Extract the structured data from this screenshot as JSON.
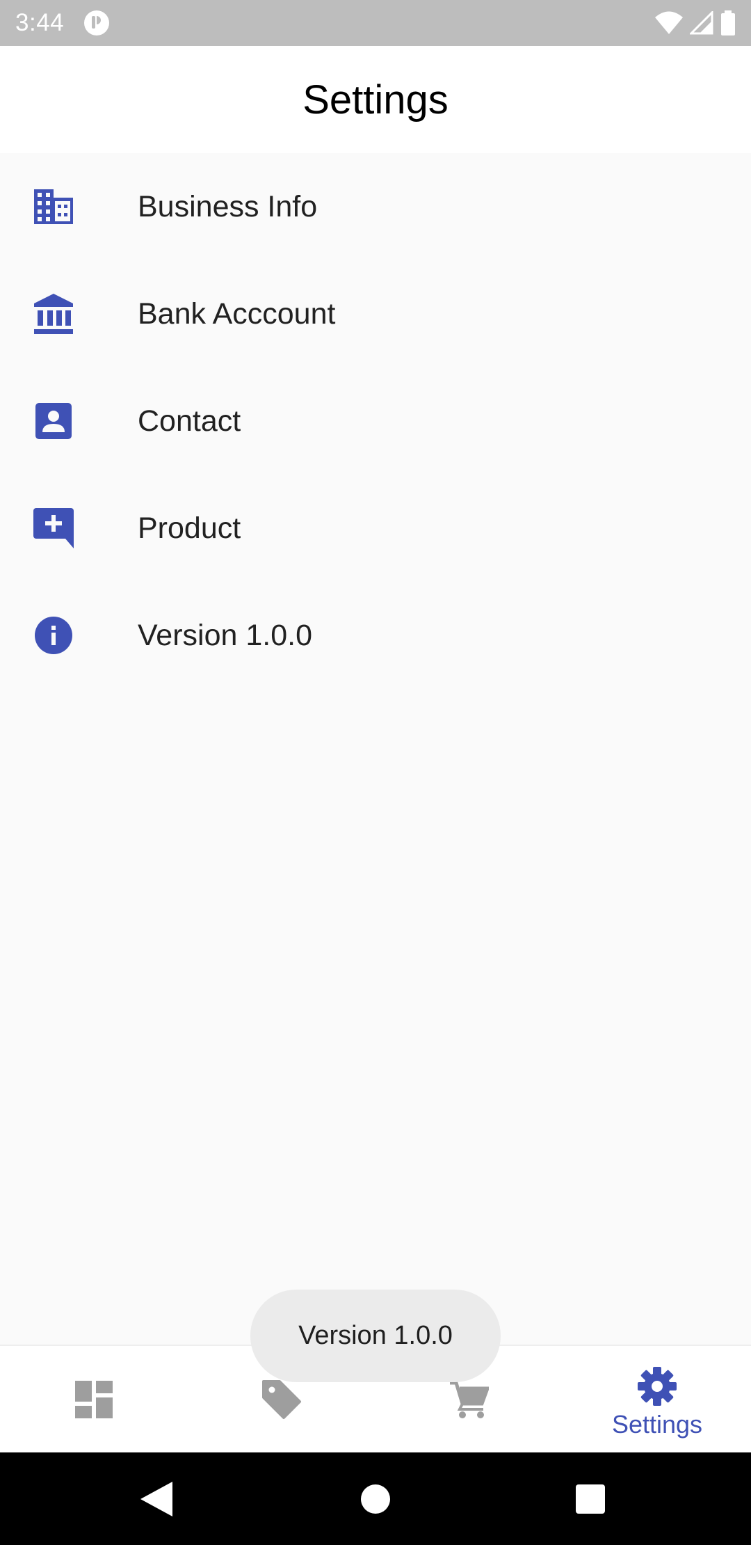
{
  "status_bar": {
    "time": "3:44"
  },
  "app_bar": {
    "title": "Settings"
  },
  "settings_items": [
    {
      "label": "Business Info",
      "icon": "business-icon"
    },
    {
      "label": "Bank Acccount",
      "icon": "bank-icon"
    },
    {
      "label": "Contact",
      "icon": "contact-card-icon"
    },
    {
      "label": "Product",
      "icon": "add-comment-icon"
    },
    {
      "label": "Version 1.0.0",
      "icon": "info-icon"
    }
  ],
  "bottom_nav": {
    "items": [
      {
        "icon": "dashboard-icon",
        "label": ""
      },
      {
        "icon": "tag-icon",
        "label": ""
      },
      {
        "icon": "cart-icon",
        "label": ""
      },
      {
        "icon": "gear-icon",
        "label": "Settings",
        "active": true
      }
    ]
  },
  "toast": {
    "text": "Version 1.0.0"
  },
  "colors": {
    "accent": "#3f51b5",
    "inactive_icon": "#9e9e9e",
    "status_bar": "#bdbdbd",
    "background": "#fafafa"
  }
}
